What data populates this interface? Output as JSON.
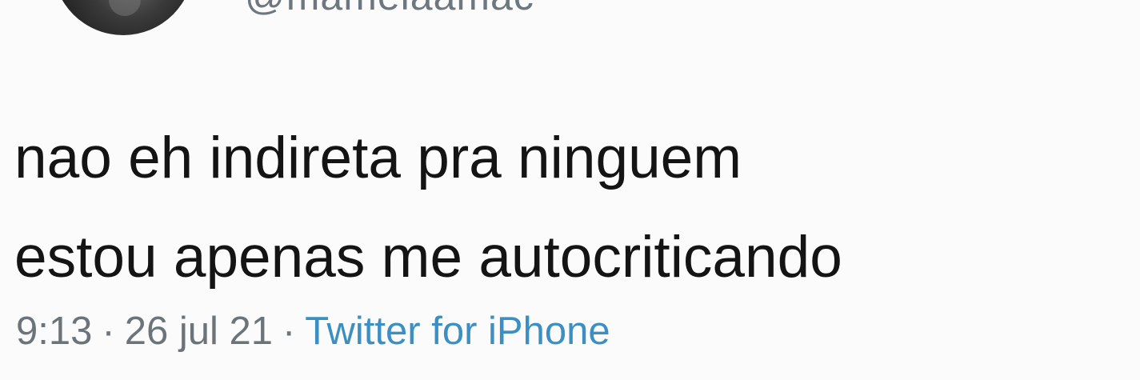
{
  "user": {
    "handle": "@mamelaamac"
  },
  "tweet": {
    "line1": "nao eh indireta pra ninguem",
    "line2": "estou apenas me autocriticando"
  },
  "meta": {
    "time": "9:13",
    "date": "26 jul 21",
    "separator": "·",
    "source": "Twitter for iPhone"
  },
  "colors": {
    "text": "#141414",
    "meta": "#6d7479",
    "link": "#3b8fc2"
  }
}
